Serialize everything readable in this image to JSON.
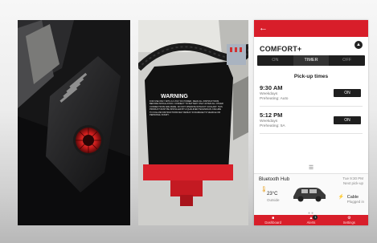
{
  "photo_panel_2": {
    "label_title": "WARNING",
    "label_text": "FOR USE ONLY WITH 12 VOLT DC POWER. READ ALL INSTRUCTIONS BEFORE INSTALLATION. CONNECT TO BATTERY ONLY AFTER ALL OTHER CONNECTIONS ARE MADE. DO NOT OPERATE WITHOUT COOLANT. THIS PRODUCT MUST BE INSTALLED BY A QUALIFIED TECHNICIAN. FAILURE TO FOLLOW INSTRUCTIONS MAY RESULT IN DAMAGE TO VEHICLE OR PERSONAL INJURY."
  },
  "app": {
    "header": {
      "back_icon": "arrow-left-icon",
      "mode_title": "COMFORT+",
      "collapse_icon": "chevron-up-icon"
    },
    "mode_tabs": [
      {
        "label": "ON",
        "active": false
      },
      {
        "label": "TIMER",
        "active": true
      },
      {
        "label": "OFF",
        "active": false
      }
    ],
    "pickup": {
      "heading": "Pick-up times",
      "items": [
        {
          "time": "9:30 AM",
          "days": "Weekdays",
          "detail": "Preheating: Auto",
          "toggle": "ON"
        },
        {
          "time": "5:12 PM",
          "days": "Weekdays",
          "detail": "Preheating: 5A",
          "toggle": "ON"
        }
      ]
    },
    "hub": {
      "title": "Bluetooth Hub",
      "next_time": "Tue 9:30 PM",
      "next_label": "Next pick-up",
      "temperature": "23°C",
      "temperature_label": "Outside",
      "cable_label": "Cable",
      "cable_status": "Plugged in"
    },
    "tabs": [
      {
        "label": "Dashboard",
        "icon": "car-icon"
      },
      {
        "label": "Alerts",
        "icon": "bell-icon",
        "badge": "1"
      },
      {
        "label": "Settings",
        "icon": "gear-icon"
      }
    ],
    "colors": {
      "accent": "#d81e2a",
      "dark": "#1f1f1f"
    }
  }
}
